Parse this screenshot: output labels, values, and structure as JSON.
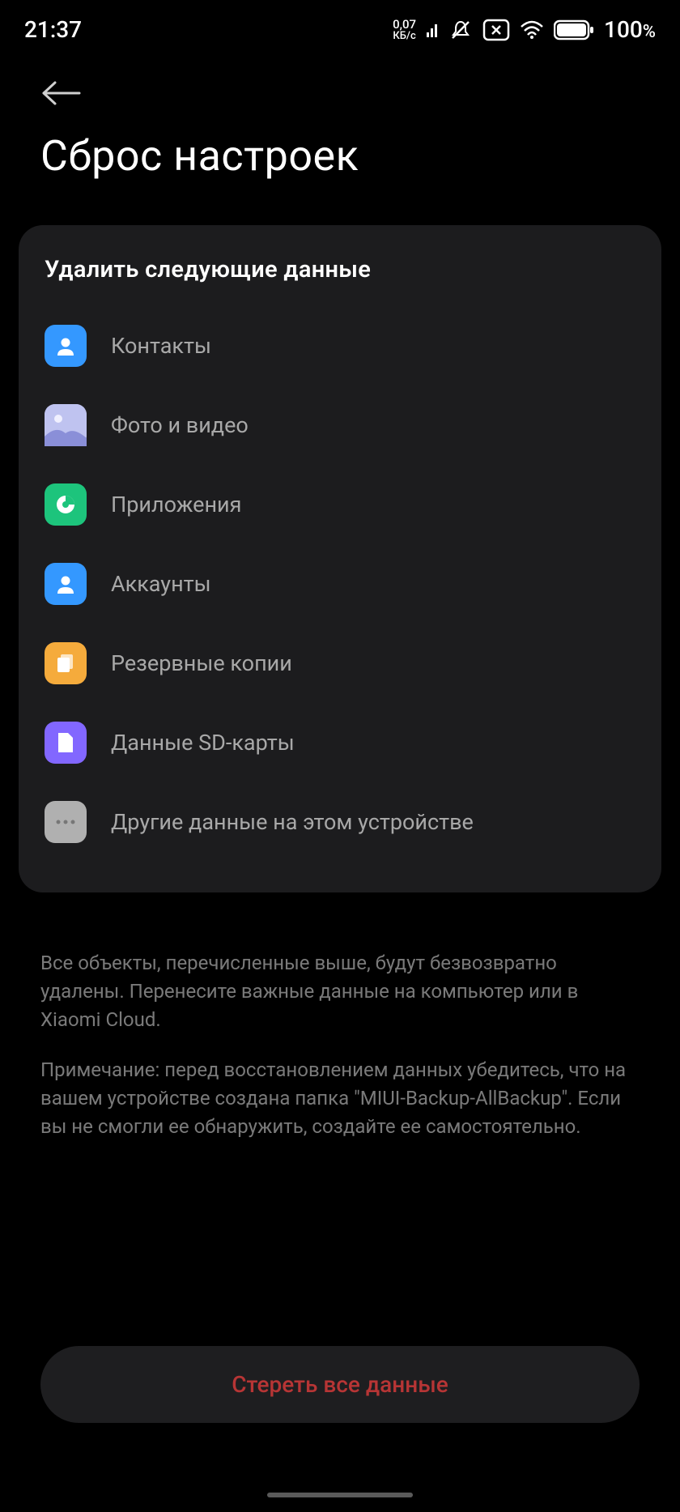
{
  "status": {
    "time": "21:37",
    "speed_value": "0,07",
    "speed_unit": "КБ/с",
    "battery": "100",
    "percent_sign": "%"
  },
  "page_title": "Сброс настроек",
  "card_title": "Удалить следующие данные",
  "items": [
    {
      "label": "Контакты"
    },
    {
      "label": "Фото и видео"
    },
    {
      "label": "Приложения"
    },
    {
      "label": "Аккаунты"
    },
    {
      "label": "Резервные копии"
    },
    {
      "label": "Данные SD-карты"
    },
    {
      "label": "Другие данные на этом устройстве"
    }
  ],
  "info": {
    "text1": "Все объекты, перечисленные выше, будут безвозвратно удалены. Перенесите важные данные на компьютер или в Xiaomi Cloud.",
    "text2": "Примечание: перед восстановлением данных убедитесь, что на вашем устройстве создана папка \"MIUI-Backup-AllBackup\". Если вы не смогли ее обнаружить, создайте ее самостоятельно."
  },
  "erase_button": "Стереть все данные"
}
